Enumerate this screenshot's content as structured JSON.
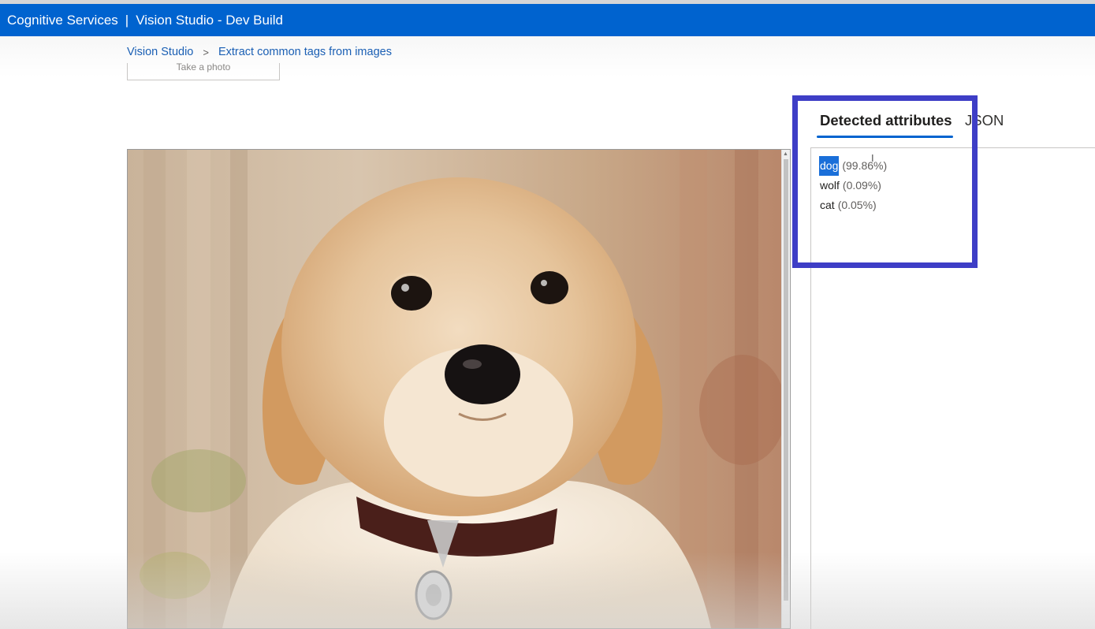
{
  "header": {
    "product": "Cognitive Services",
    "separator": "|",
    "app": "Vision Studio - Dev Build"
  },
  "breadcrumb": {
    "root": "Vision Studio",
    "chevron": ">",
    "current": "Extract common tags from images"
  },
  "photo_button": {
    "label": "Take a photo"
  },
  "tabs": {
    "detected": "Detected attributes",
    "json": "JSON"
  },
  "results": [
    {
      "name": "dog",
      "confidence": "(99.86%)",
      "selected": true
    },
    {
      "name": "wolf",
      "confidence": "(0.09%)",
      "selected": false
    },
    {
      "name": "cat",
      "confidence": "(0.05%)",
      "selected": false
    }
  ],
  "colors": {
    "header": "#0063cf",
    "link": "#1a5fb4",
    "highlight_box": "#3e3ec6",
    "selection": "#1a6fd9"
  },
  "icons": {
    "cursor": "text-cursor-icon",
    "scroll_up": "scroll-up-arrow-icon"
  }
}
